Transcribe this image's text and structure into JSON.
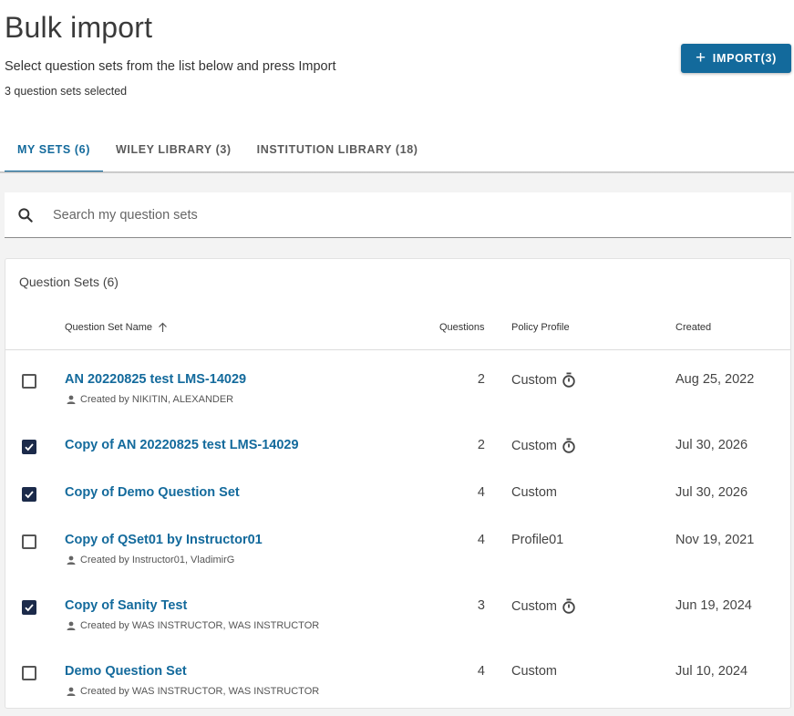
{
  "header": {
    "title": "Bulk import",
    "subtitle": "Select question sets from the list below and press Import",
    "selected_count": "3 question sets selected",
    "import_button_label": "IMPORT(3)"
  },
  "tabs": [
    {
      "label": "MY SETS (6)",
      "active": true
    },
    {
      "label": "WILEY LIBRARY (3)",
      "active": false
    },
    {
      "label": "INSTITUTION LIBRARY (18)",
      "active": false
    }
  ],
  "search": {
    "placeholder": "Search my question sets",
    "value": ""
  },
  "table": {
    "title": "Question Sets (6)",
    "columns": {
      "name": "Question Set Name",
      "questions": "Questions",
      "policy": "Policy Profile",
      "created": "Created"
    },
    "rows": [
      {
        "checked": false,
        "name": "AN 20220825 test LMS-14029",
        "created_by": "Created by NIKITIN, ALEXANDER",
        "questions": "2",
        "policy": "Custom",
        "timer": true,
        "created": "Aug 25, 2022"
      },
      {
        "checked": true,
        "name": "Copy of AN 20220825 test LMS-14029",
        "created_by": "",
        "questions": "2",
        "policy": "Custom",
        "timer": true,
        "created": "Jul 30, 2026"
      },
      {
        "checked": true,
        "name": "Copy of Demo Question Set",
        "created_by": "",
        "questions": "4",
        "policy": "Custom",
        "timer": false,
        "created": "Jul 30, 2026"
      },
      {
        "checked": false,
        "name": "Copy of QSet01 by Instructor01",
        "created_by": "Created by Instructor01, VladimirG",
        "questions": "4",
        "policy": "Profile01",
        "timer": false,
        "created": "Nov 19, 2021"
      },
      {
        "checked": true,
        "name": "Copy of Sanity Test",
        "created_by": "Created by WAS INSTRUCTOR, WAS INSTRUCTOR",
        "questions": "3",
        "policy": "Custom",
        "timer": true,
        "created": "Jun 19, 2024"
      },
      {
        "checked": false,
        "name": "Demo Question Set",
        "created_by": "Created by WAS INSTRUCTOR, WAS INSTRUCTOR",
        "questions": "4",
        "policy": "Custom",
        "timer": false,
        "created": "Jul 10, 2024"
      }
    ]
  },
  "colors": {
    "primary": "#136a9c",
    "checkbox_checked": "#1b2a4a"
  },
  "icons": [
    "plus-icon",
    "search-icon",
    "sort-ascending-icon",
    "person-icon",
    "timer-icon",
    "checkmark-icon"
  ]
}
